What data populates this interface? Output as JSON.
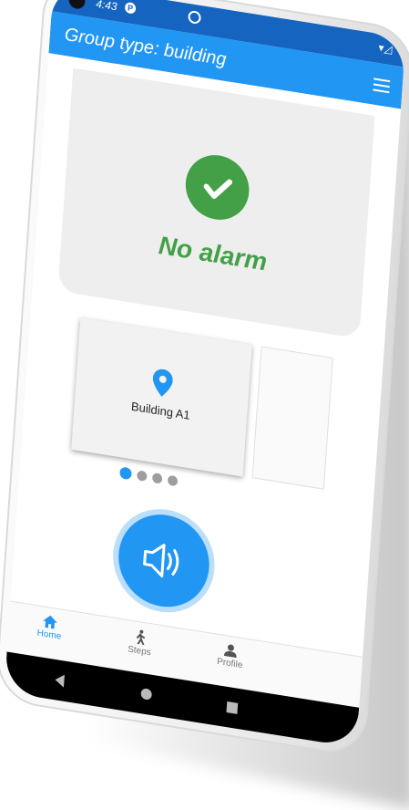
{
  "status_bar": {
    "time": "4:43",
    "app_icon": "P"
  },
  "app_bar": {
    "title": "Group type: building",
    "menu_icon": "hamburger-menu-icon"
  },
  "alarm_status": {
    "text": "No alarm",
    "icon": "check-circle-icon",
    "color": "#43a047"
  },
  "carousel": {
    "items": [
      {
        "label": "Building A1",
        "icon": "location-pin-icon"
      }
    ],
    "page_count": 4,
    "active_index": 0
  },
  "sound_button": {
    "icon": "speaker-volume-icon"
  },
  "bottom_nav": {
    "items": [
      {
        "label": "Home",
        "icon": "home-icon",
        "active": true
      },
      {
        "label": "Steps",
        "icon": "walking-icon",
        "active": false
      },
      {
        "label": "Profile",
        "icon": "person-icon",
        "active": false
      }
    ]
  },
  "colors": {
    "primary": "#2196f3",
    "status_bar": "#1565c0",
    "success": "#43a047"
  }
}
